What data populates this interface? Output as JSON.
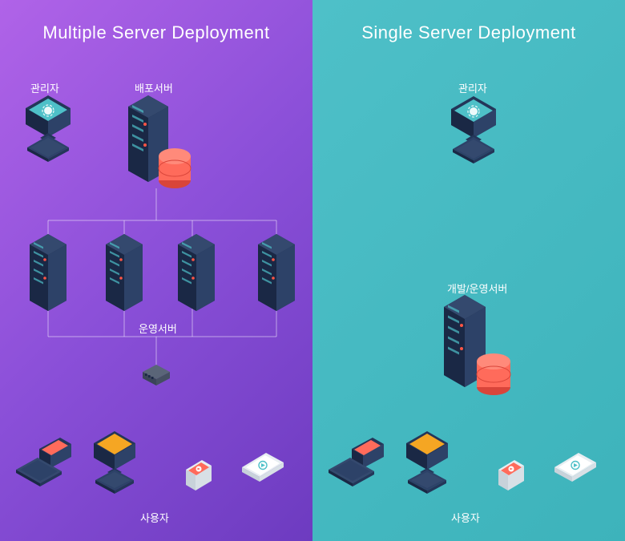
{
  "left": {
    "title": "Multiple Server Deployment",
    "admin": "관리자",
    "deploy_server": "배포서버",
    "prod_server": "운영서버",
    "users": "사용자"
  },
  "right": {
    "title": "Single Server Deployment",
    "admin": "관리자",
    "dev_prod_server": "개발/운영서버",
    "users": "사용자"
  },
  "colors": {
    "server_dark": "#1a2845",
    "server_face": "#243659",
    "server_light": "#2d4268",
    "screen_orange": "#f5a623",
    "screen_teal": "#4ec0c8",
    "db_red": "#ff6b5b",
    "accent_red": "#ff5544"
  }
}
